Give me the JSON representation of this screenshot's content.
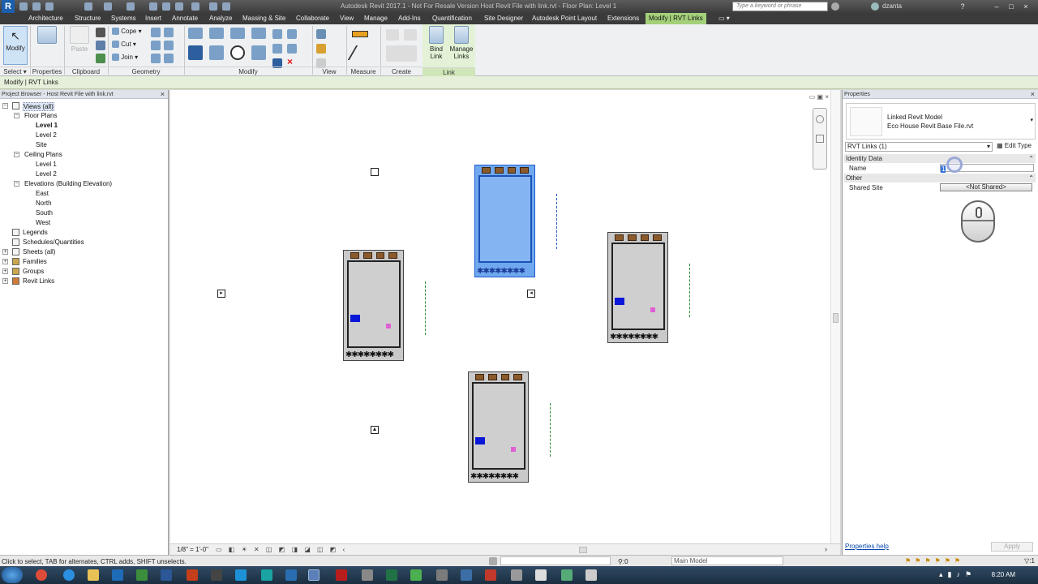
{
  "app": {
    "logo": "R",
    "window_title": "Autodesk Revit 2017.1 - Not For Resale Version     Host Revit File with link.rvt - Floor Plan: Level 1",
    "search_placeholder": "Type a keyword or phrase",
    "username": "dzanta"
  },
  "ribbon_tabs": [
    "Architecture",
    "Structure",
    "Systems",
    "Insert",
    "Annotate",
    "Analyze",
    "Massing & Site",
    "Collaborate",
    "View",
    "Manage",
    "Add-Ins",
    "Quantification",
    "Site Designer",
    "Autodesk Point Layout",
    "Extensions",
    "Modify | RVT Links"
  ],
  "active_tab": "Modify | RVT Links",
  "ribbon": {
    "modify_label": "Modify",
    "paste_label": "Paste",
    "cope_label": "Cope",
    "cut_label": "Cut",
    "join_label": "Join",
    "bind_link_label": "Bind\nLink",
    "manage_links_label": "Manage\nLinks",
    "panels": {
      "select": "Select",
      "properties": "Properties",
      "clipboard": "Clipboard",
      "geometry": "Geometry",
      "modify": "Modify",
      "view": "View",
      "measure": "Measure",
      "create": "Create",
      "link": "Link"
    }
  },
  "options_bar": {
    "context": "Modify | RVT Links"
  },
  "project_browser": {
    "title": "Project Browser - Host Revit File with link.rvt",
    "items": {
      "views_all": "Views (all)",
      "floor_plans": "Floor Plans",
      "fp_level1": "Level 1",
      "fp_level2": "Level 2",
      "fp_site": "Site",
      "ceiling_plans": "Ceiling Plans",
      "cp_level1": "Level 1",
      "cp_level2": "Level 2",
      "elevations": "Elevations (Building Elevation)",
      "east": "East",
      "north": "North",
      "south": "South",
      "west": "West",
      "legends": "Legends",
      "schedules": "Schedules/Quantities",
      "sheets": "Sheets (all)",
      "families": "Families",
      "groups": "Groups",
      "revit_links": "Revit Links"
    }
  },
  "view_control_bar": {
    "scale": "1/8\" = 1'-0\""
  },
  "properties": {
    "title": "Properties",
    "type_family": "Linked Revit Model",
    "type_name": "Eco House Revit Base File.rvt",
    "selector": "RVT Links (1)",
    "edit_type": "Edit Type",
    "groups": {
      "identity": "Identity Data",
      "other": "Other"
    },
    "name_label": "Name",
    "name_value": "1",
    "shared_site_label": "Shared Site",
    "shared_site_value": "<Not Shared>",
    "help_link": "Properties help",
    "apply": "Apply"
  },
  "status": {
    "message": "Click to select, TAB for alternates, CTRL adds, SHIFT unselects.",
    "selection_count": ":0",
    "model": "Main Model",
    "filter_count": ":1"
  },
  "taskbar": {
    "time": "8:20 AM"
  },
  "plan_trees": "✱✱✱✱✱✱✱✱"
}
